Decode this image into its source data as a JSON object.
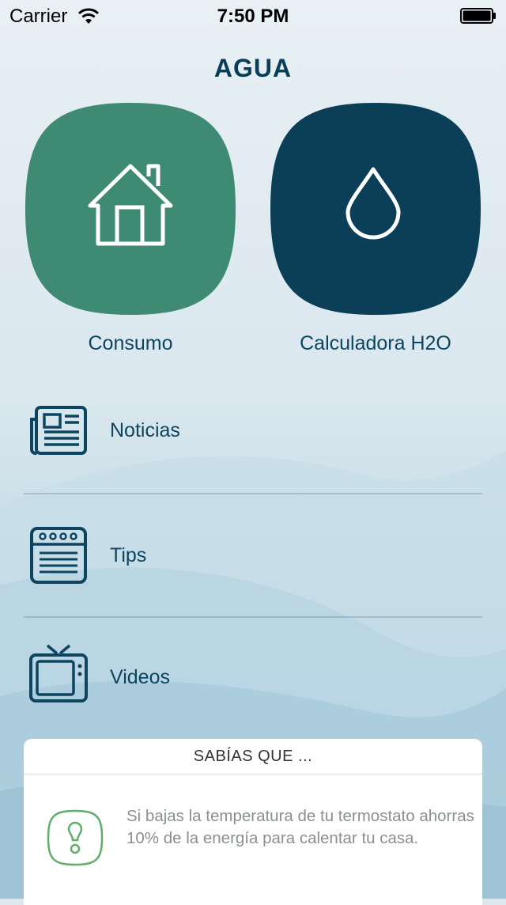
{
  "status_bar": {
    "carrier": "Carrier",
    "time": "7:50 PM"
  },
  "app": {
    "title": "AGUA"
  },
  "tiles": [
    {
      "label": "Consumo",
      "icon": "house-icon",
      "color": "#3e8a73"
    },
    {
      "label": "Calculadora H2O",
      "icon": "water-drop-icon",
      "color": "#0b3f58"
    }
  ],
  "menu": [
    {
      "label": "Noticias",
      "icon": "newspaper-icon"
    },
    {
      "label": "Tips",
      "icon": "notepad-icon"
    },
    {
      "label": "Videos",
      "icon": "tv-icon"
    }
  ],
  "tip_card": {
    "header": "SABÍAS QUE ...",
    "text": "Si bajas la temperatura de tu termostato ahorras 10% de la energía para calentar tu casa.",
    "icon": "lightbulb-icon",
    "icon_color": "#5fae6a"
  },
  "colors": {
    "primary_text": "#0d4560",
    "background": "#dde9ef"
  }
}
